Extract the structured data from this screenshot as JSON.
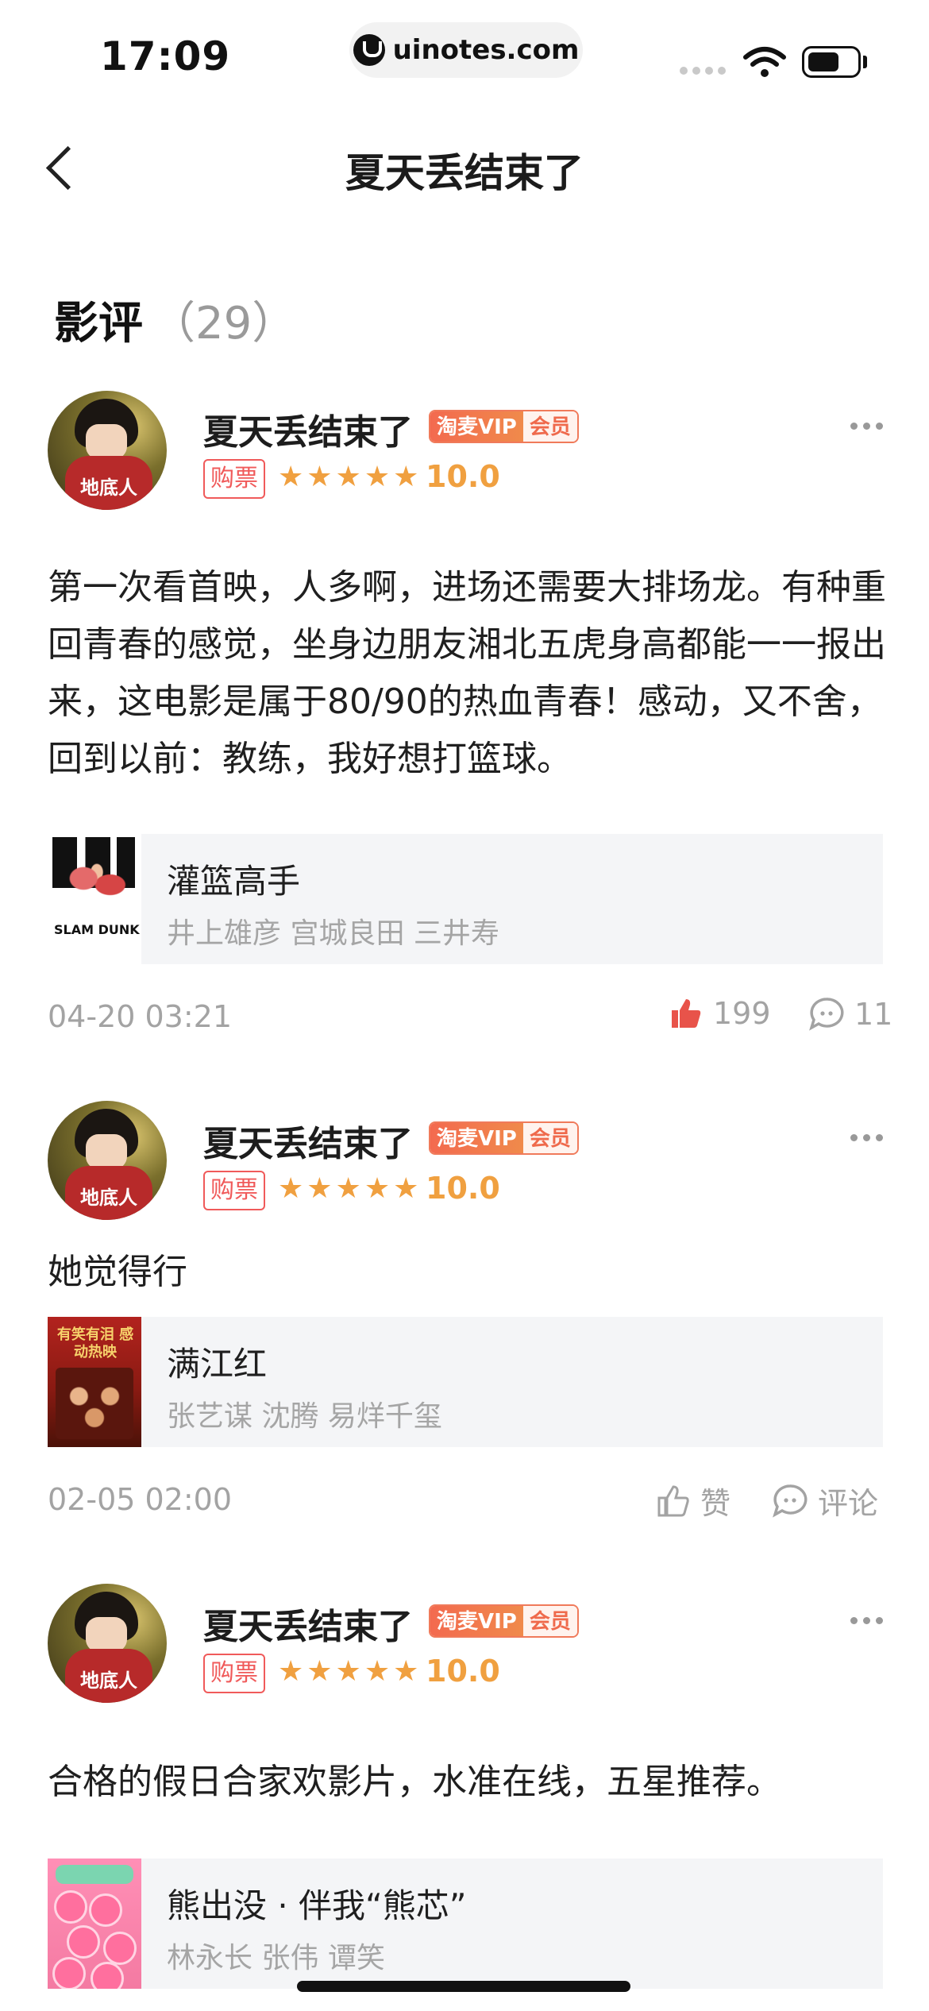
{
  "status_bar": {
    "time": "17:09",
    "url": "uinotes.com"
  },
  "nav": {
    "title": "夏天丢结束了"
  },
  "section": {
    "title": "影评",
    "count": "（29）"
  },
  "reviews": [
    {
      "username": "夏天丢结束了",
      "vip_left": "淘麦VIP",
      "vip_right": "会员",
      "ticket": "购票",
      "stars": "★★★★★",
      "score": "10.0",
      "text": "第一次看首映，人多啊，进场还需要大排场龙。有种重回青春的感觉，坐身边朋友湘北五虎身高都能一一报出来，这电影是属于80/90的热血青春！感动，又不舍，回到以前：教练，我好想打篮球。",
      "movie_title": "灌篮高手",
      "movie_cast": "井上雄彦 宫城良田 三井寿",
      "date": "04-20 03:21",
      "likes": "199",
      "comments": "11"
    },
    {
      "username": "夏天丢结束了",
      "vip_left": "淘麦VIP",
      "vip_right": "会员",
      "ticket": "购票",
      "stars": "★★★★★",
      "score": "10.0",
      "text": "她觉得行",
      "movie_title": "满江红",
      "movie_cast": "张艺谋 沈腾 易烊千玺",
      "date": "02-05 02:00",
      "likes": "赞",
      "comments": "评论"
    },
    {
      "username": "夏天丢结束了",
      "vip_left": "淘麦VIP",
      "vip_right": "会员",
      "ticket": "购票",
      "stars": "★★★★★",
      "score": "10.0",
      "text": "合格的假日合家欢影片，水准在线，五星推荐。",
      "movie_title": "熊出没 · 伴我“熊芯”",
      "movie_cast": "林永长 张伟 谭笑"
    }
  ],
  "avatar_shirt_text": "地底人",
  "poster_texts": {
    "slam": "SLAM DUNK",
    "red": "有笑有泪 感动热映"
  },
  "colors": {
    "accent_orange": "#f0a040",
    "ticket_red": "#f05a5a",
    "like_active": "#e8534a",
    "muted_text": "#a3a3a3",
    "card_bg": "#f4f5f7"
  },
  "icons": [
    "back-arrow-icon",
    "more-dots-icon",
    "thumbs-up-icon",
    "comment-bubble-icon",
    "wifi-icon",
    "battery-icon"
  ]
}
